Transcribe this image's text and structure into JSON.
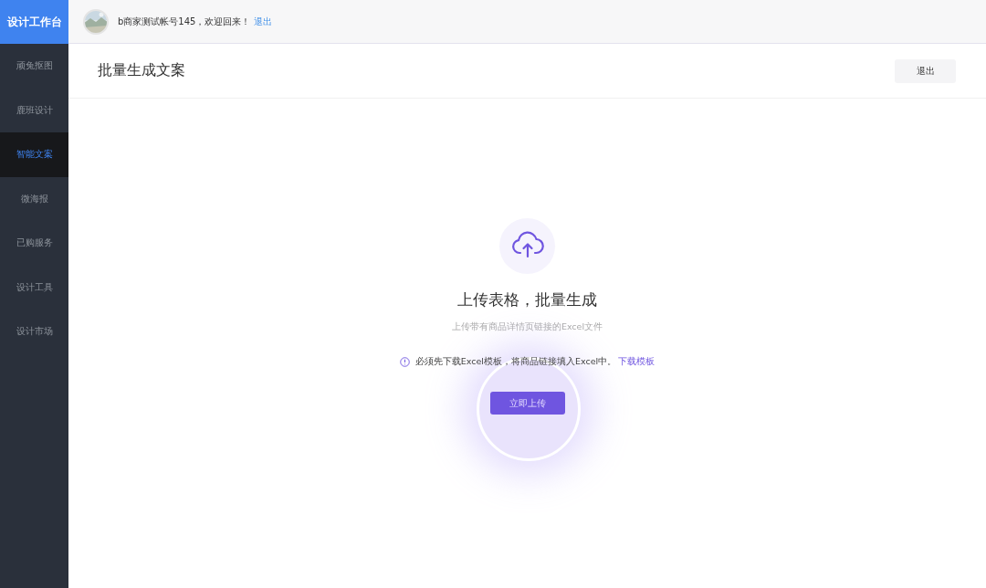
{
  "sidebar": {
    "logo": "设计工作台",
    "items": [
      {
        "label": "顽兔抠图",
        "selected": false
      },
      {
        "label": "鹿班设计",
        "selected": false
      },
      {
        "label": "智能文案",
        "selected": true
      },
      {
        "label": "微海报",
        "selected": false
      },
      {
        "label": "已购服务",
        "selected": false
      },
      {
        "label": "设计工具",
        "selected": false
      },
      {
        "label": "设计市场",
        "selected": false
      }
    ]
  },
  "header": {
    "greeting": "b商家测试帐号145，欢迎回来！",
    "logout_link": "退出"
  },
  "page": {
    "title": "批量生成文案",
    "exit_button": "退出"
  },
  "upload": {
    "heading": "上传表格，批量生成",
    "subtitle": "上传带有商品详情页链接的Excel文件",
    "notice": "必须先下载Excel模板，将商品链接填入Excel中。",
    "notice_link": "下载模板",
    "button": "立即上传"
  }
}
